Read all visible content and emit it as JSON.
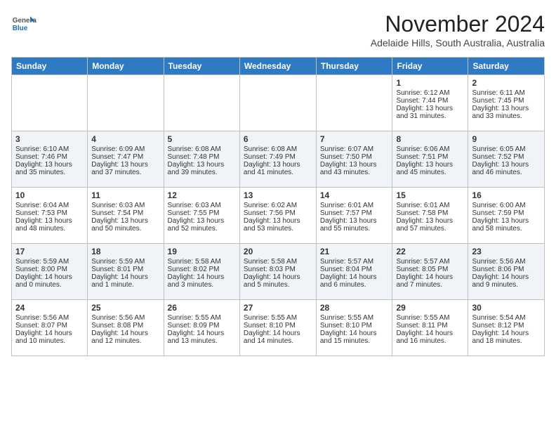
{
  "header": {
    "logo": {
      "general": "General",
      "blue": "Blue"
    },
    "title": "November 2024",
    "subtitle": "Adelaide Hills, South Australia, Australia"
  },
  "calendar": {
    "days": [
      "Sunday",
      "Monday",
      "Tuesday",
      "Wednesday",
      "Thursday",
      "Friday",
      "Saturday"
    ],
    "weeks": [
      [
        {
          "day": "",
          "content": ""
        },
        {
          "day": "",
          "content": ""
        },
        {
          "day": "",
          "content": ""
        },
        {
          "day": "",
          "content": ""
        },
        {
          "day": "",
          "content": ""
        },
        {
          "day": "1",
          "content": "Sunrise: 6:12 AM\nSunset: 7:44 PM\nDaylight: 13 hours and 31 minutes."
        },
        {
          "day": "2",
          "content": "Sunrise: 6:11 AM\nSunset: 7:45 PM\nDaylight: 13 hours and 33 minutes."
        }
      ],
      [
        {
          "day": "3",
          "content": "Sunrise: 6:10 AM\nSunset: 7:46 PM\nDaylight: 13 hours and 35 minutes."
        },
        {
          "day": "4",
          "content": "Sunrise: 6:09 AM\nSunset: 7:47 PM\nDaylight: 13 hours and 37 minutes."
        },
        {
          "day": "5",
          "content": "Sunrise: 6:08 AM\nSunset: 7:48 PM\nDaylight: 13 hours and 39 minutes."
        },
        {
          "day": "6",
          "content": "Sunrise: 6:08 AM\nSunset: 7:49 PM\nDaylight: 13 hours and 41 minutes."
        },
        {
          "day": "7",
          "content": "Sunrise: 6:07 AM\nSunset: 7:50 PM\nDaylight: 13 hours and 43 minutes."
        },
        {
          "day": "8",
          "content": "Sunrise: 6:06 AM\nSunset: 7:51 PM\nDaylight: 13 hours and 45 minutes."
        },
        {
          "day": "9",
          "content": "Sunrise: 6:05 AM\nSunset: 7:52 PM\nDaylight: 13 hours and 46 minutes."
        }
      ],
      [
        {
          "day": "10",
          "content": "Sunrise: 6:04 AM\nSunset: 7:53 PM\nDaylight: 13 hours and 48 minutes."
        },
        {
          "day": "11",
          "content": "Sunrise: 6:03 AM\nSunset: 7:54 PM\nDaylight: 13 hours and 50 minutes."
        },
        {
          "day": "12",
          "content": "Sunrise: 6:03 AM\nSunset: 7:55 PM\nDaylight: 13 hours and 52 minutes."
        },
        {
          "day": "13",
          "content": "Sunrise: 6:02 AM\nSunset: 7:56 PM\nDaylight: 13 hours and 53 minutes."
        },
        {
          "day": "14",
          "content": "Sunrise: 6:01 AM\nSunset: 7:57 PM\nDaylight: 13 hours and 55 minutes."
        },
        {
          "day": "15",
          "content": "Sunrise: 6:01 AM\nSunset: 7:58 PM\nDaylight: 13 hours and 57 minutes."
        },
        {
          "day": "16",
          "content": "Sunrise: 6:00 AM\nSunset: 7:59 PM\nDaylight: 13 hours and 58 minutes."
        }
      ],
      [
        {
          "day": "17",
          "content": "Sunrise: 5:59 AM\nSunset: 8:00 PM\nDaylight: 14 hours and 0 minutes."
        },
        {
          "day": "18",
          "content": "Sunrise: 5:59 AM\nSunset: 8:01 PM\nDaylight: 14 hours and 1 minute."
        },
        {
          "day": "19",
          "content": "Sunrise: 5:58 AM\nSunset: 8:02 PM\nDaylight: 14 hours and 3 minutes."
        },
        {
          "day": "20",
          "content": "Sunrise: 5:58 AM\nSunset: 8:03 PM\nDaylight: 14 hours and 5 minutes."
        },
        {
          "day": "21",
          "content": "Sunrise: 5:57 AM\nSunset: 8:04 PM\nDaylight: 14 hours and 6 minutes."
        },
        {
          "day": "22",
          "content": "Sunrise: 5:57 AM\nSunset: 8:05 PM\nDaylight: 14 hours and 7 minutes."
        },
        {
          "day": "23",
          "content": "Sunrise: 5:56 AM\nSunset: 8:06 PM\nDaylight: 14 hours and 9 minutes."
        }
      ],
      [
        {
          "day": "24",
          "content": "Sunrise: 5:56 AM\nSunset: 8:07 PM\nDaylight: 14 hours and 10 minutes."
        },
        {
          "day": "25",
          "content": "Sunrise: 5:56 AM\nSunset: 8:08 PM\nDaylight: 14 hours and 12 minutes."
        },
        {
          "day": "26",
          "content": "Sunrise: 5:55 AM\nSunset: 8:09 PM\nDaylight: 14 hours and 13 minutes."
        },
        {
          "day": "27",
          "content": "Sunrise: 5:55 AM\nSunset: 8:10 PM\nDaylight: 14 hours and 14 minutes."
        },
        {
          "day": "28",
          "content": "Sunrise: 5:55 AM\nSunset: 8:10 PM\nDaylight: 14 hours and 15 minutes."
        },
        {
          "day": "29",
          "content": "Sunrise: 5:55 AM\nSunset: 8:11 PM\nDaylight: 14 hours and 16 minutes."
        },
        {
          "day": "30",
          "content": "Sunrise: 5:54 AM\nSunset: 8:12 PM\nDaylight: 14 hours and 18 minutes."
        }
      ]
    ]
  }
}
